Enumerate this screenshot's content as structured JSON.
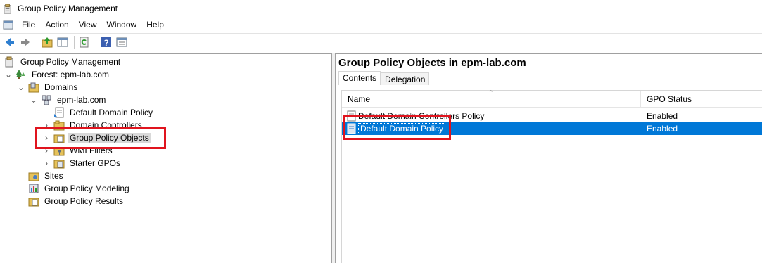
{
  "window": {
    "title": "Group Policy Management"
  },
  "menu": {
    "items": [
      "File",
      "Action",
      "View",
      "Window",
      "Help"
    ]
  },
  "toolbar": {
    "buttons": [
      "back-icon",
      "forward-icon",
      "up-folder-icon",
      "show-hide-tree-icon",
      "refresh-icon",
      "help-icon",
      "properties-icon"
    ]
  },
  "tree": {
    "root": "Group Policy Management",
    "forest": "Forest: epm-lab.com",
    "domains": "Domains",
    "domain": "epm-lab.com",
    "default_policy": "Default Domain Policy",
    "domain_controllers": "Domain Controllers",
    "gpo": "Group Policy Objects",
    "wmi": "WMI Filters",
    "starter": "Starter GPOs",
    "sites": "Sites",
    "modeling": "Group Policy Modeling",
    "results": "Group Policy Results"
  },
  "details": {
    "title": "Group Policy Objects in epm-lab.com",
    "tabs": [
      "Contents",
      "Delegation"
    ],
    "columns": {
      "name": "Name",
      "status": "GPO Status"
    },
    "rows": [
      {
        "name": "Default Domain Controllers Policy",
        "status": "Enabled"
      },
      {
        "name": "Default Domain Policy",
        "status": "Enabled"
      }
    ]
  },
  "colors": {
    "selection": "#0078d7",
    "highlight_box": "#e0141e"
  }
}
